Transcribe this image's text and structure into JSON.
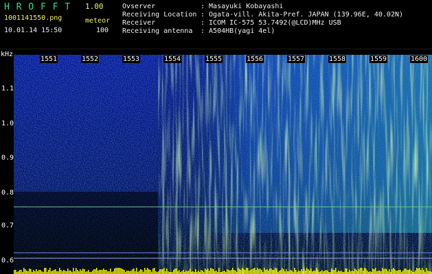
{
  "app": {
    "title": "H R O F F T",
    "version": "1.00",
    "filename": "1001141550.png",
    "mode": "meteor",
    "datetime": "10.01.14 15:50",
    "count": "100"
  },
  "info": {
    "labels": [
      "Ovserver",
      "Receiving Location",
      "Receiver",
      "Receiving antenna"
    ],
    "values": [
      ": Masayuki Kobayashi",
      ": Ogata-vill. Akita-Pref. JAPAN (139.96E, 40.02N)",
      ": ICOM IC-575 53.7492(@LCD)MHz USB",
      ": A504HB(yagi 4el)"
    ]
  },
  "axes": {
    "y_unit": "kHz",
    "y_ticks": [
      "1.1",
      "1.0",
      "0.9",
      "0.8",
      "0.7",
      "0.6"
    ],
    "time_ticks": [
      "1551",
      "1552",
      "1553",
      "1554",
      "1555",
      "1556",
      "1557",
      "1558",
      "1559",
      "1600"
    ]
  },
  "colors": {
    "background": "#000000",
    "header_green": "#2fe08a",
    "header_white": "#f2f2f2",
    "header_yellow": "#f2f26a",
    "bottom_bar": "#f5f500"
  }
}
